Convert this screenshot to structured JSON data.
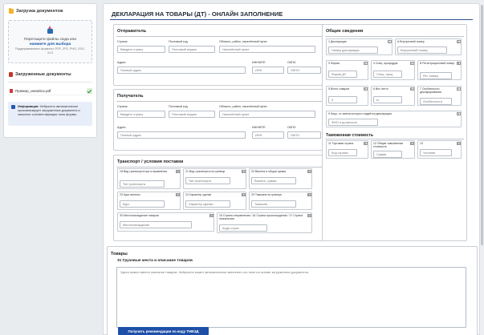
{
  "sidebar": {
    "upload_title": "Загрузка документов",
    "drop_text": "Перетащите файлы сюда или",
    "drop_link": "нажмите для выбора",
    "formats": "Поддерживаемые форматы: PDF, JPG, PNG, DOC, XLS",
    "uploaded_title": "Загруженные документы",
    "file_name": "Пример_инвойса.pdf",
    "info_bold": "Информация:",
    "info_text": "Нейросеть автоматически проанализирует загруженные документы и заполнит соответствующие поля формы."
  },
  "main": {
    "title": "ДЕКЛАРАЦИЯ НА ТОВАРЫ (ДТ) - ОНЛАЙН ЗАПОЛНЕНИЕ"
  },
  "sender": {
    "title": "Отправитель",
    "badge": "2",
    "country_label": "Страна",
    "country_ph": "Введите страну",
    "postal_label": "Почтовый код",
    "postal_ph": "Почтовый индекс",
    "region_label": "Область, район, населённый пункт",
    "region_ph": "Населённый пункт",
    "address_label": "Адрес",
    "address_ph": "Полный адрес",
    "inn_label": "ИНН/КПП",
    "inn_ph": "ИНН",
    "okpo_label": "ОКПО",
    "okpo_ph": "ОКПО"
  },
  "receiver": {
    "title": "Получатель",
    "badge": "8",
    "country_label": "Страна",
    "country_ph": "Введите страну",
    "postal_label": "Почтовый код",
    "postal_ph": "Почтовый индекс",
    "region_label": "Область, район, населённый пункт",
    "region_ph": "Населённый пункт",
    "address_label": "Адрес",
    "address_ph": "Полный адрес",
    "inn_label": "ИНН/КПП",
    "inn_ph": "ИНН",
    "okpo_label": "ОКПО",
    "okpo_ph": "ОКПО"
  },
  "general": {
    "title": "Общие сведения",
    "c1_num": "1",
    "c1_label": "1 Декларация",
    "c1_ph": "Номер декларации",
    "cA_num": "A",
    "cA_label": "А Внутренний номер",
    "cA_ph": "Внутренний номер",
    "c3_num": "3",
    "c3_label": "3 Форма",
    "c3_ph": "Форма ДТ",
    "c4_num": "4",
    "c4_label": "4 Спец. процедура",
    "c4_ph": "Спец. проц.",
    "cB_num": "B",
    "cB_label": "B Регистрационный номер",
    "cB_ph": "Рег. номер",
    "c5_num": "5",
    "c5_label": "5 Всего товаров",
    "c5_ph": "0",
    "c6_num": "6",
    "c6_label": "6 Вес нетто",
    "c6_ph": "кг",
    "c7_num": "7",
    "c7_label": "7 Особенности декларирования",
    "c7_ph": "Особенности",
    "c9_num": "9",
    "c9_label": "9 Лицо, от имени которого подаётся декларация",
    "c9_ph": "ФИО и должность"
  },
  "customs_value": {
    "title": "Таможенная стоимость",
    "c11_num": "11",
    "c11_label": "11 Торговая страна",
    "c11_ph": "Код страны",
    "c12_num": "12",
    "c12_label": "12 Общая таможенная стоимость",
    "c12_ph": "Сумма",
    "c13_num": "13",
    "c13_label": "13",
    "c13_ph": "Условия"
  },
  "transport": {
    "title": "Транспорт / условия поставки",
    "c18_num": "18",
    "c18_label": "18 Вид транспорта при отправлении",
    "c18_ph": "Тип транспорта",
    "c21_num": "21",
    "c21_label": "21 Вид транспорта на границе",
    "c21_ph": "Тип транспорта",
    "c22_num": "22",
    "c22_label": "22 Валюта и общая сумма",
    "c22_ph": "Валюта, сумма",
    "c23_num": "23",
    "c23_label": "23 Курс валюты",
    "c23_ph": "Курс",
    "c24_num": "24",
    "c24_label": "24 Характер сделки",
    "c24_ph": "Характер сделки",
    "c29_num": "29",
    "c29_label": "29 Таможня на границе",
    "c29_ph": "Таможня",
    "c30_num": "30",
    "c30_label": "30 Местонахождение товаров",
    "c30_ph": "Местонахождение",
    "c15_num": "15",
    "c15_label": "15 Страна отправления / 16 Страна происхождения / 17 Страна назначения",
    "c15_ph": "Коды стран"
  },
  "goods": {
    "title": "Товары",
    "subtitle": "31 Грузовые места и описание товаров",
    "desc_ph": "Здесь можно ввести описание товаров. Нейросеть может автоматически заполнить это поле на основе загруженных документов.",
    "button": "Получить рекомендации по коду ТНВЭД"
  }
}
